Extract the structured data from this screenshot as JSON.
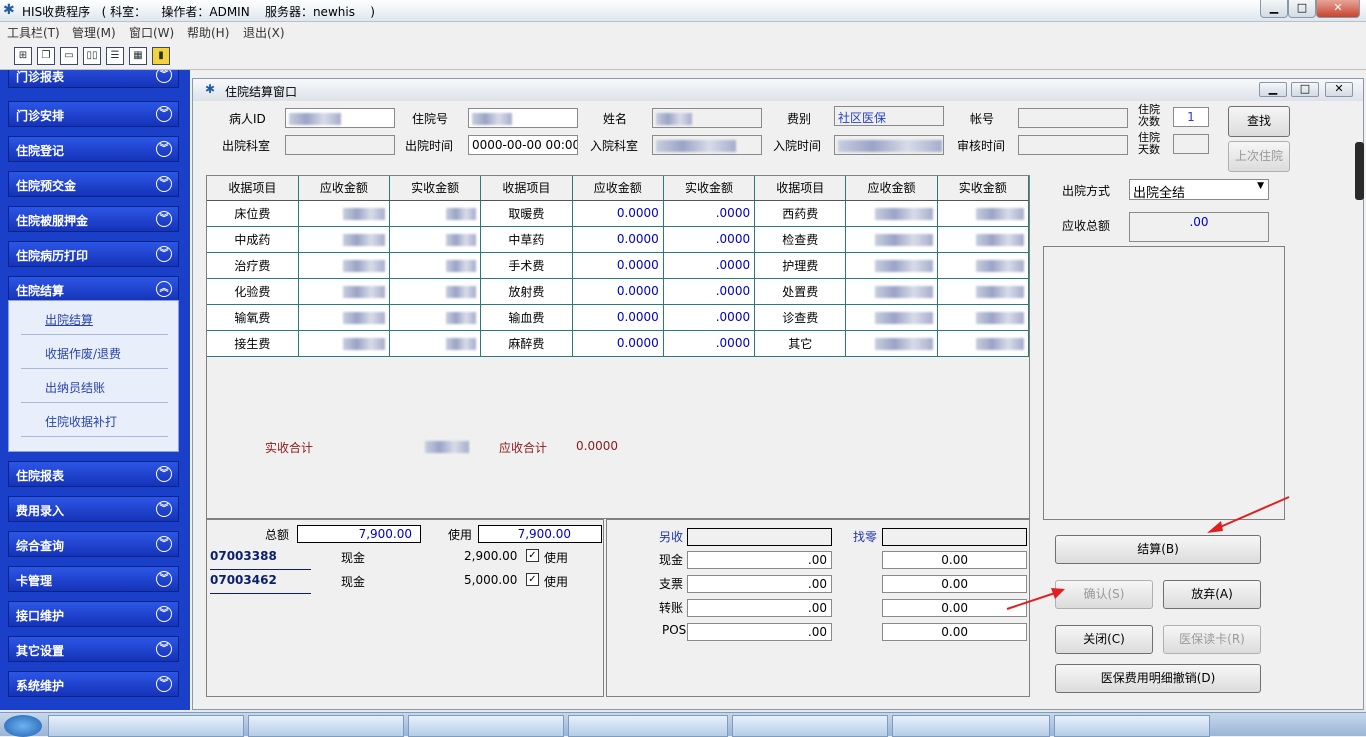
{
  "titlebar": {
    "title": "HIS收费程序   ( 科室：    操作者：ADMIN    服务器：newhis    )",
    "min": "▁",
    "max": "□",
    "close": "✕"
  },
  "menu": [
    "工具栏(T)",
    "管理(M)",
    "窗口(W)",
    "帮助(H)",
    "退出(X)"
  ],
  "toolbar_icons": [
    "tree-icon",
    "window-stack-icon",
    "window-icon",
    "tile-vertical-icon",
    "tile-horizontal-icon",
    "grid-icon",
    "exit-door-icon"
  ],
  "nav": {
    "top_cut": "门诊报表",
    "items": [
      "门诊安排",
      "住院登记",
      "住院预交金",
      "住院被服押金",
      "住院病历打印",
      "住院结算"
    ],
    "sub": [
      "出院结算",
      "收据作废/退费",
      "出纳员结账",
      "住院收据补打"
    ],
    "items2": [
      "住院报表",
      "费用录入",
      "综合查询",
      "卡管理",
      "接口维护",
      "其它设置",
      "系统维护"
    ]
  },
  "window": {
    "title": "住院结算窗口"
  },
  "form": {
    "patient_id": "病人ID",
    "adm_no": "住院号",
    "name": "姓名",
    "fee_type": "费别",
    "fee_type_val": "社区医保",
    "account": "帐号",
    "admit_count": "住院\n次数",
    "admit_count_val": "1",
    "dept_out": "出院科室",
    "out_time": "出院时间",
    "out_time_val": "0000-00-00 00:00",
    "dept_in": "入院科室",
    "in_time": "入院时间",
    "audit_time": "审核时间",
    "stay_days": "住院\n天数"
  },
  "buttons": {
    "search": "查找",
    "last_adm": "上次住院",
    "settle": "结算(B)",
    "confirm": "确认(S)",
    "abandon": "放弃(A)",
    "close": "关闭(C)",
    "read_card": "医保读卡(R)",
    "cancel_detail": "医保费用明细撤销(D)"
  },
  "discharge": {
    "method_label": "出院方式",
    "method_val": "出院全结",
    "total_label": "应收总额",
    "total_val": ".00"
  },
  "grid": {
    "headers": [
      "收据项目",
      "应收金额",
      "实收金额",
      "收据项目",
      "应收金额",
      "实收金额",
      "收据项目",
      "应收金额",
      "实收金额"
    ],
    "rows": [
      [
        "床位费",
        "取暖费",
        "0.0000",
        ".0000",
        "西药费"
      ],
      [
        "中成药",
        "中草药",
        "0.0000",
        ".0000",
        "检查费"
      ],
      [
        "治疗费",
        "手术费",
        "0.0000",
        ".0000",
        "护理费"
      ],
      [
        "化验费",
        "放射费",
        "0.0000",
        ".0000",
        "处置费"
      ],
      [
        "输氧费",
        "输血费",
        "0.0000",
        ".0000",
        "诊查费"
      ],
      [
        "接生费",
        "麻醉费",
        "0.0000",
        ".0000",
        "其它"
      ]
    ],
    "actual_total_label": "实收合计",
    "due_total_label": "应收合计",
    "due_total_val": "0.0000"
  },
  "deposit": {
    "total_label": "总额",
    "total_val": "7,900.00",
    "use_label": "使用",
    "use_val": "7,900.00",
    "rows": [
      {
        "no": "07003388",
        "type": "现金",
        "amount": "2,900.00",
        "use": "使用"
      },
      {
        "no": "07003462",
        "type": "现金",
        "amount": "5,000.00",
        "use": "使用"
      }
    ]
  },
  "payment": {
    "extra_label": "另收",
    "change_label": "找零",
    "rows": [
      {
        "label": "现金",
        "val": ".00",
        "r": "0.00"
      },
      {
        "label": "支票",
        "val": ".00",
        "r": "0.00"
      },
      {
        "label": "转账",
        "val": ".00",
        "r": "0.00"
      },
      {
        "label": "POS",
        "val": ".00",
        "r": "0.00"
      }
    ]
  }
}
